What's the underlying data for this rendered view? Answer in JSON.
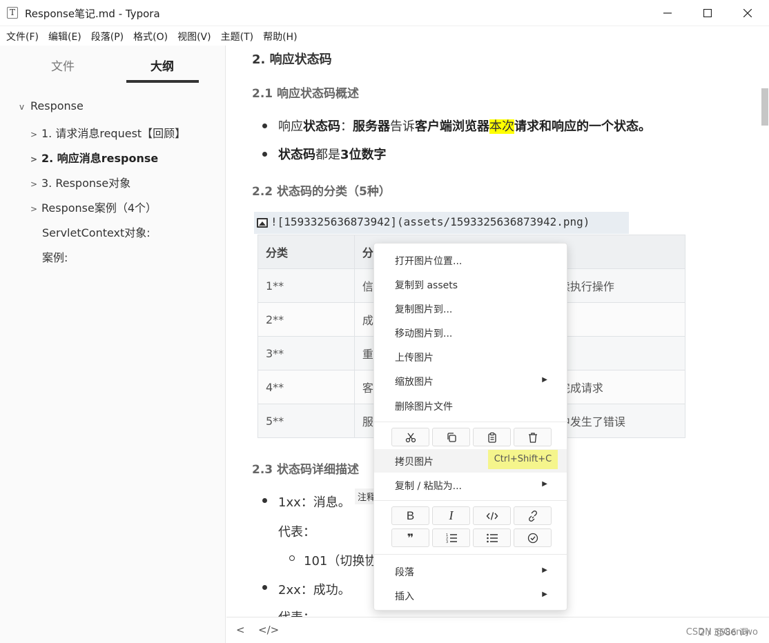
{
  "window": {
    "title": "Response笔记.md - Typora",
    "app_icon_letter": "T"
  },
  "menubar": [
    "文件(F)",
    "编辑(E)",
    "段落(P)",
    "格式(O)",
    "视图(V)",
    "主题(T)",
    "帮助(H)"
  ],
  "sidebar": {
    "tabs": [
      "文件",
      "大纲"
    ],
    "active_tab": "大纲",
    "outline": [
      {
        "label": "Response",
        "chevron": "v"
      },
      {
        "label": "1. 请求消息request【回顾】",
        "chevron": ">"
      },
      {
        "label": "2. 响应消息response",
        "chevron": ">"
      },
      {
        "label": "3. Response对象",
        "chevron": ">"
      },
      {
        "label": "Response案例（4个）",
        "chevron": ">"
      },
      {
        "label": "ServletContext对象:"
      },
      {
        "label": "案例:"
      }
    ]
  },
  "editor": {
    "h2": "2. 响应状态码",
    "h3_1": "2.1 响应状态码概述",
    "b1": {
      "p1": "响应",
      "b1": "状态码",
      "p2": "：",
      "b2": "服务器",
      "p3": "告诉",
      "b3": "客户端浏览器",
      "hl": "本次",
      "b4": "请求和响应的一个状态。"
    },
    "b2": {
      "b1": "状态码",
      "p1": "都是",
      "b2": "3位数字"
    },
    "h3_2": "2.2 状态码的分类（5种）",
    "image_source": "![1593325636873942](assets/1593325636873942.png)",
    "table": {
      "headers": [
        "分类",
        "分"
      ],
      "rows": [
        {
          "c1": "1**",
          "c2": "信",
          "c3": "续执行操作"
        },
        {
          "c1": "2**",
          "c2": "成",
          "c3": ""
        },
        {
          "c1": "3**",
          "c2": "重",
          "c3": ""
        },
        {
          "c1": "4**",
          "c2": "客",
          "c3": "完成请求"
        },
        {
          "c1": "5**",
          "c2": "服",
          "c3": "中发生了错误"
        }
      ]
    },
    "h3_3": "2.3 状态码详细描述",
    "l1": "1xx：消息。",
    "tag": "注释",
    "l1_sub": "代表：",
    "l1_item": "101（切换协",
    "l2": "2xx：成功。",
    "l2_sub": "代表："
  },
  "context_menu": {
    "items_top": [
      "打开图片位置...",
      "复制到 assets",
      "复制图片到...",
      "移动图片到...",
      "上传图片",
      "缩放图片",
      "删除图片文件"
    ],
    "submenu_flags": [
      false,
      false,
      false,
      false,
      false,
      true,
      false
    ],
    "icon_row_1": [
      "cut-icon",
      "copy-icon",
      "paste-icon",
      "delete-icon"
    ],
    "copy_image": "拷贝图片",
    "copy_image_shortcut": "Ctrl+Shift+C",
    "copy_paste_as": "复制 / 粘贴为...",
    "format_icons_1": [
      "bold-icon",
      "italic-icon",
      "code-icon",
      "link-icon"
    ],
    "format_icons_2": [
      "quote-icon",
      "ordered-list-icon",
      "unordered-list-icon",
      "task-list-icon"
    ],
    "bold_glyph": "B",
    "italic_glyph": "I",
    "quote_glyph": "❞",
    "paragraph": "段落",
    "insert": "插入"
  },
  "footer": {
    "back": "<",
    "source": "</>",
    "word_count": "2 / 3586 词",
    "watermark": "CSDN @Gentwo"
  }
}
